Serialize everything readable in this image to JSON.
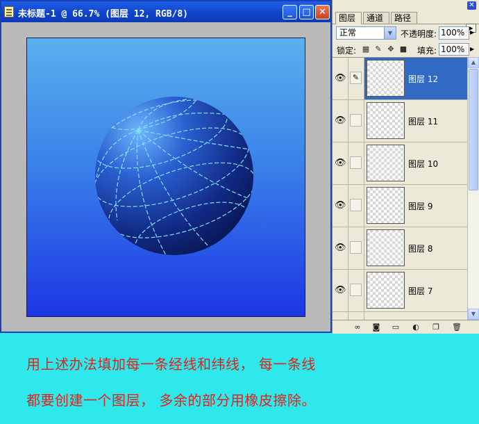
{
  "document": {
    "title": "未标题-1 @ 66.7% (图层 12, RGB/8)",
    "buttons": {
      "minimize": "_",
      "maximize": "□",
      "close": "✕"
    }
  },
  "layers_panel": {
    "tabs": [
      "图层",
      "通道",
      "路径"
    ],
    "blend_mode": "正常",
    "opacity_label": "不透明度:",
    "opacity_value": "100%",
    "lock_label": "锁定:",
    "fill_label": "填充:",
    "fill_value": "100%",
    "layers": [
      {
        "name": "图层 12",
        "visible": true,
        "selected": true
      },
      {
        "name": "图层 11",
        "visible": true,
        "selected": false
      },
      {
        "name": "图层 10",
        "visible": true,
        "selected": false
      },
      {
        "name": "图层 9",
        "visible": true,
        "selected": false
      },
      {
        "name": "图层 8",
        "visible": true,
        "selected": false
      },
      {
        "name": "图层 7",
        "visible": true,
        "selected": false
      }
    ],
    "footer_icons": [
      "link-layers-icon",
      "add-layer-style-icon",
      "add-mask-icon",
      "new-group-icon",
      "adjustment-layer-icon",
      "new-layer-icon",
      "delete-layer-icon"
    ]
  },
  "caption": {
    "line1": "用上述办法填加每一条经线和纬线， 每一条线",
    "line2": "都要创建一个图层， 多余的部分用橡皮擦除。"
  },
  "colors": {
    "title_bar": "#0f43c8",
    "selected_layer": "#316ac5",
    "caption_text": "#e0231c",
    "background": "#2ee8ec",
    "grid_lines": "#7fe3f0"
  }
}
